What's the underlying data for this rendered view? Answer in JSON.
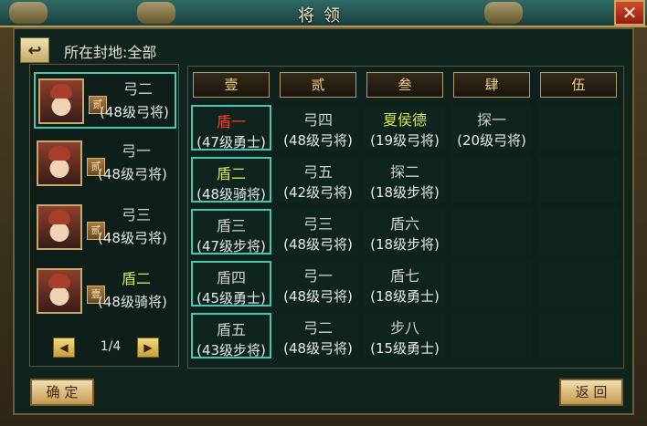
{
  "window": {
    "title": "将领",
    "close_glyph": "✕"
  },
  "header": {
    "back_glyph": "↩",
    "fief_label": "所在封地:全部"
  },
  "generals": [
    {
      "name": "弓二",
      "badge": "贰",
      "sub": "(48级弓将)",
      "selected": true,
      "name_color": "white"
    },
    {
      "name": "弓一",
      "badge": "贰",
      "sub": "(48级弓将)",
      "selected": false,
      "name_color": "white"
    },
    {
      "name": "弓三",
      "badge": "贰",
      "sub": "(48级弓将)",
      "selected": false,
      "name_color": "white"
    },
    {
      "name": "盾二",
      "badge": "壹",
      "sub": "(48级骑将)",
      "selected": false,
      "name_color": "yellow"
    }
  ],
  "pager": {
    "prev_glyph": "◀",
    "text": "1/4",
    "next_glyph": "▶"
  },
  "columns": [
    "壹",
    "贰",
    "叁",
    "肆",
    "伍"
  ],
  "grid": [
    [
      {
        "name": "盾一",
        "sub": "(47级勇士)",
        "color": "red",
        "selected": true
      },
      {
        "name": "弓四",
        "sub": "(48级弓将)",
        "color": "white",
        "selected": false
      },
      {
        "name": "夏侯德",
        "sub": "(19级弓将)",
        "color": "yellow",
        "selected": false
      },
      {
        "name": "探一",
        "sub": "(20级弓将)",
        "color": "white",
        "selected": false
      },
      {
        "name": "",
        "sub": "",
        "color": "white",
        "selected": false
      }
    ],
    [
      {
        "name": "盾二",
        "sub": "(48级骑将)",
        "color": "yellow",
        "selected": true
      },
      {
        "name": "弓五",
        "sub": "(42级弓将)",
        "color": "white",
        "selected": false
      },
      {
        "name": "探二",
        "sub": "(18级步将)",
        "color": "white",
        "selected": false
      },
      {
        "name": "",
        "sub": "",
        "color": "white",
        "selected": false
      },
      {
        "name": "",
        "sub": "",
        "color": "white",
        "selected": false
      }
    ],
    [
      {
        "name": "盾三",
        "sub": "(47级步将)",
        "color": "white",
        "selected": true
      },
      {
        "name": "弓三",
        "sub": "(48级弓将)",
        "color": "white",
        "selected": false
      },
      {
        "name": "盾六",
        "sub": "(18级步将)",
        "color": "white",
        "selected": false
      },
      {
        "name": "",
        "sub": "",
        "color": "white",
        "selected": false
      },
      {
        "name": "",
        "sub": "",
        "color": "white",
        "selected": false
      }
    ],
    [
      {
        "name": "盾四",
        "sub": "(45级勇士)",
        "color": "white",
        "selected": true
      },
      {
        "name": "弓一",
        "sub": "(48级弓将)",
        "color": "white",
        "selected": false
      },
      {
        "name": "盾七",
        "sub": "(18级勇士)",
        "color": "white",
        "selected": false
      },
      {
        "name": "",
        "sub": "",
        "color": "white",
        "selected": false
      },
      {
        "name": "",
        "sub": "",
        "color": "white",
        "selected": false
      }
    ],
    [
      {
        "name": "盾五",
        "sub": "(43级步将)",
        "color": "white",
        "selected": true
      },
      {
        "name": "弓二",
        "sub": "(48级弓将)",
        "color": "white",
        "selected": false
      },
      {
        "name": "步八",
        "sub": "(15级勇士)",
        "color": "white",
        "selected": false
      },
      {
        "name": "",
        "sub": "",
        "color": "white",
        "selected": false
      },
      {
        "name": "",
        "sub": "",
        "color": "white",
        "selected": false
      }
    ]
  ],
  "buttons": {
    "confirm": "确 定",
    "return": "返 回"
  }
}
